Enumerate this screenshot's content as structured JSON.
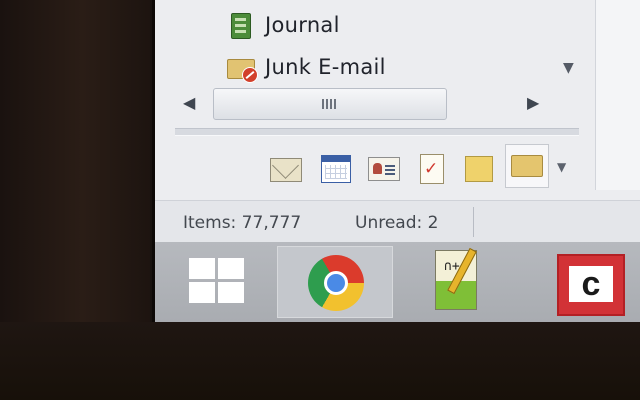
{
  "folders": [
    {
      "label": "Journal",
      "icon": "journal-icon"
    },
    {
      "label": "Junk E-mail",
      "icon": "junk-email-icon"
    }
  ],
  "navigation": [
    "mail-icon",
    "calendar-icon",
    "contacts-icon",
    "tasks-icon",
    "notes-icon",
    "folder-list-icon"
  ],
  "status": {
    "items": "Items: 77,777",
    "unread": "Unread: 2"
  },
  "taskbar": {
    "apps": [
      "windows-start-icon",
      "chrome-icon",
      "notepad-plus-plus-icon",
      "c-app-icon"
    ]
  },
  "icons": {
    "notepad_mark": "∩++",
    "c_app_letter": "c"
  },
  "colors": {
    "accent_red": "#d23236",
    "folder_yellow": "#e4c56e",
    "taskbar": "#aeb1b6"
  }
}
